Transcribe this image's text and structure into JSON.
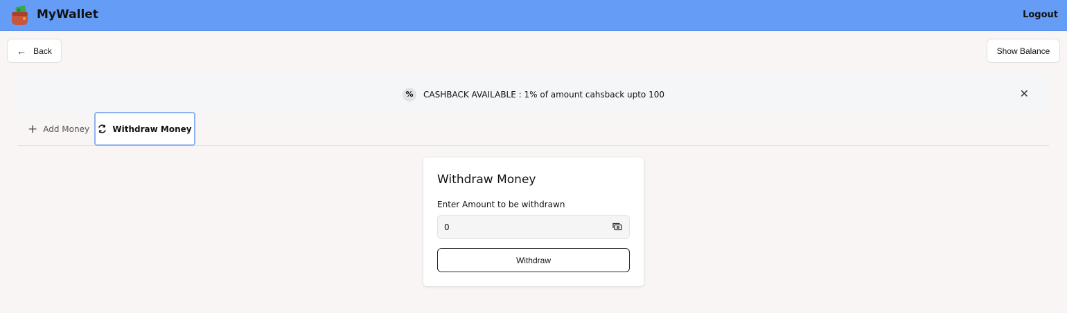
{
  "navbar": {
    "brand": "MyWallet",
    "logout_label": "Logout",
    "logo_icon": "wallet-icon",
    "color": "#659cf5"
  },
  "actions": {
    "back_label": "Back",
    "show_balance_label": "Show Balance"
  },
  "banner": {
    "badge": "%",
    "text": "CASHBACK AVAILABLE : 1% of amount cahsback upto 100",
    "close": "✕"
  },
  "tabs": [
    {
      "label": "Add Money",
      "icon": "plus-icon",
      "active": false
    },
    {
      "label": "Withdraw Money",
      "icon": "refresh-icon",
      "active": true
    }
  ],
  "withdraw_card": {
    "title": "Withdraw Money",
    "amount_label": "Enter Amount to be withdrawn",
    "amount_value": "0",
    "amount_icon": "cash-icon",
    "button_label": "Withdraw"
  },
  "colors": {
    "page_bg": "#f8f5f4",
    "banner_bg": "#f4f6f8",
    "active_tab_border": "#8eb2ee"
  }
}
